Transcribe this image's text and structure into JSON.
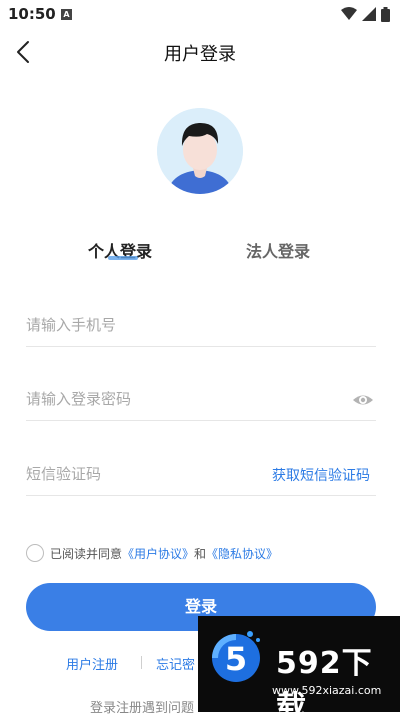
{
  "status": {
    "time": "10:50",
    "notification_badge": "A"
  },
  "header": {
    "title": "用户登录"
  },
  "tabs": {
    "personal": "个人登录",
    "legal": "法人登录"
  },
  "form": {
    "phone_placeholder": "请输入手机号",
    "password_placeholder": "请输入登录密码",
    "sms_placeholder": "短信验证码",
    "sms_button": "获取短信验证码"
  },
  "agreement": {
    "prefix": "已阅读并同意",
    "user_agreement": "《用户协议》",
    "and": "和",
    "privacy_agreement": "《隐私协议》"
  },
  "login_button": "登录",
  "links": {
    "register": "用户注册",
    "forgot": "忘记密"
  },
  "help_text": "登录注册遇到问题",
  "watermark": {
    "title": "592下载",
    "url": "www.592xiazai.com",
    "logo_digit": "5"
  },
  "colors": {
    "primary": "#3a7fe6",
    "link": "#2c7be5"
  }
}
